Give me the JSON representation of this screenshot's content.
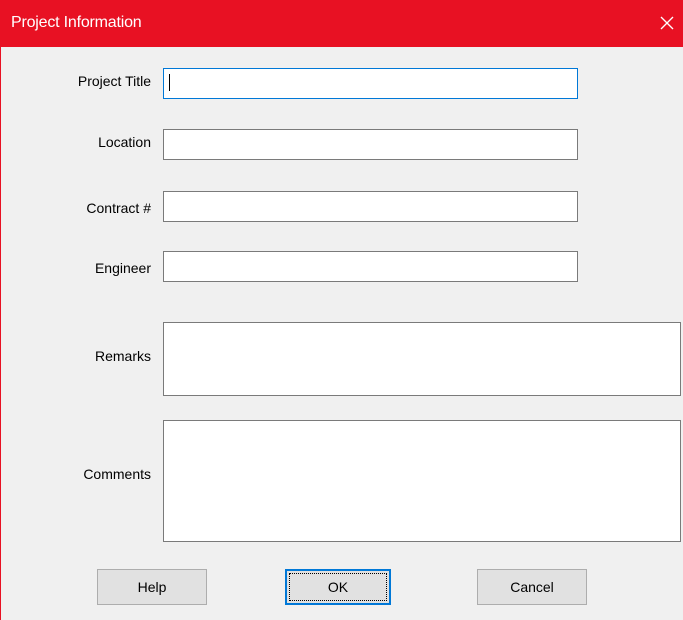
{
  "window": {
    "title": "Project Information",
    "accent_color": "#e81123",
    "close_icon": "close-icon"
  },
  "form": {
    "fields": [
      {
        "key": "project_title",
        "label": "Project Title",
        "value": ""
      },
      {
        "key": "location",
        "label": "Location",
        "value": ""
      },
      {
        "key": "contract",
        "label": "Contract #",
        "value": ""
      },
      {
        "key": "engineer",
        "label": "Engineer",
        "value": ""
      },
      {
        "key": "remarks",
        "label": "Remarks",
        "value": ""
      },
      {
        "key": "comments",
        "label": "Comments",
        "value": ""
      }
    ]
  },
  "buttons": {
    "help": "Help",
    "ok": "OK",
    "cancel": "Cancel"
  }
}
